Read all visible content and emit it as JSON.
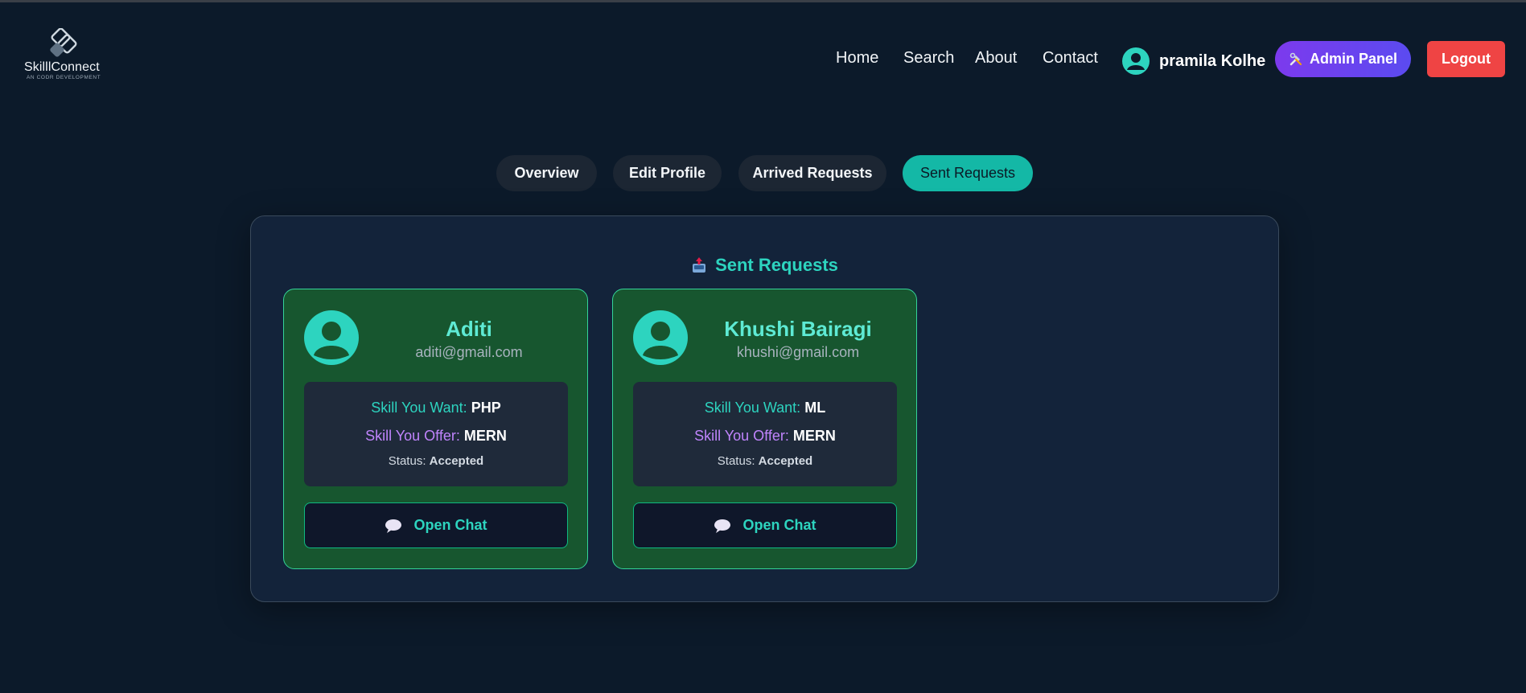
{
  "brand": {
    "name": "SkilllConnect",
    "tagline": "AN CODR DEVELOPMENT"
  },
  "nav": {
    "links": [
      "Home",
      "Search",
      "About",
      "Contact"
    ]
  },
  "user": {
    "name": "pramila Kolhe"
  },
  "buttons": {
    "admin": "Admin Panel",
    "logout": "Logout"
  },
  "tabs": [
    {
      "label": "Overview",
      "active": false
    },
    {
      "label": "Edit Profile",
      "active": false
    },
    {
      "label": "Arrived Requests",
      "active": false
    },
    {
      "label": "Sent Requests",
      "active": true
    }
  ],
  "panel": {
    "title": "Sent Requests"
  },
  "requests": [
    {
      "name": "Aditi",
      "email": "aditi@gmail.com",
      "want_label": "Skill You Want:",
      "want": "PHP",
      "offer_label": "Skill You Offer:",
      "offer": "MERN",
      "status_label": "Status:",
      "status": "Accepted",
      "chat_label": "Open Chat"
    },
    {
      "name": "Khushi Bairagi",
      "email": "khushi@gmail.com",
      "want_label": "Skill You Want:",
      "want": "ML",
      "offer_label": "Skill You Offer:",
      "offer": "MERN",
      "status_label": "Status:",
      "status": "Accepted",
      "chat_label": "Open Chat"
    }
  ],
  "icons": {
    "user_avatar": "user-circle-icon",
    "admin": "tools-icon",
    "panel_title": "outbox-tray-icon",
    "chat": "speech-bubble-icon"
  },
  "colors": {
    "background": "#0c1a2a",
    "accent": "#14b8a6",
    "card": "#17562f",
    "admin_gradient_start": "#7c3aed",
    "admin_gradient_end": "#5b4bf0",
    "logout": "#ef4444",
    "offer_label": "#c084fc"
  }
}
